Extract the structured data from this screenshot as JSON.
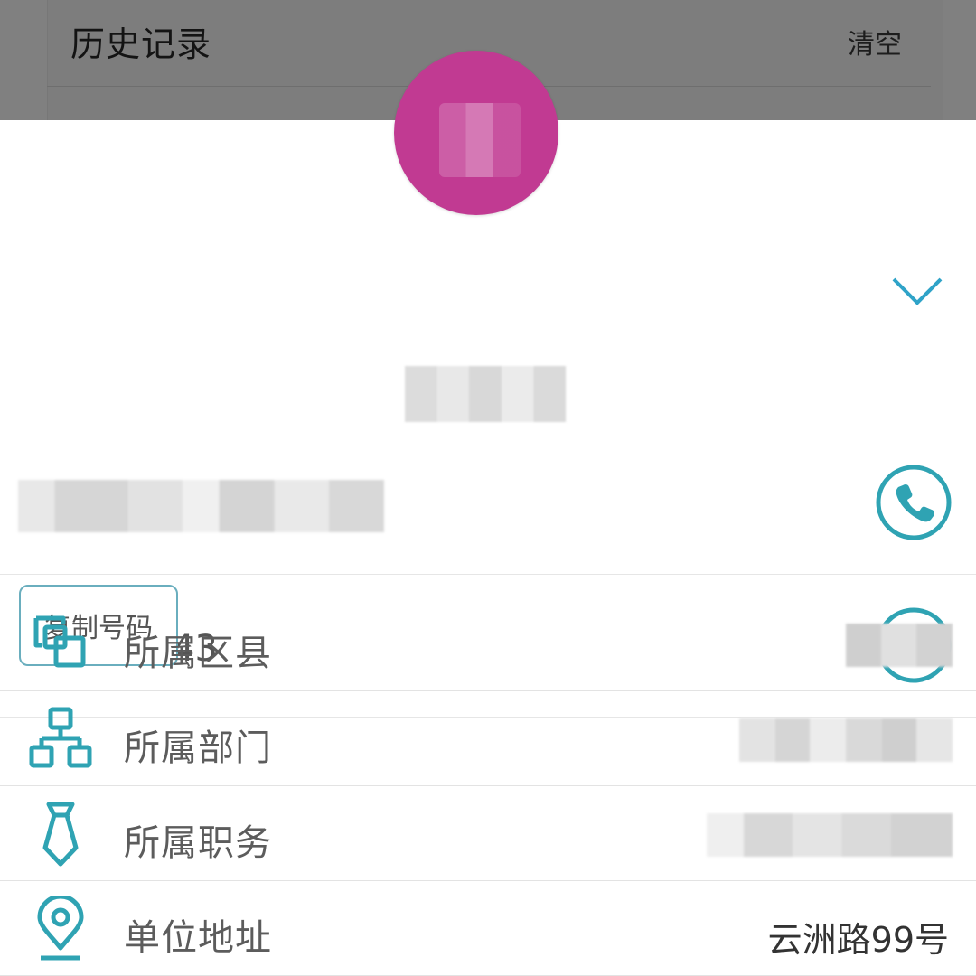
{
  "history": {
    "title": "历史记录",
    "clear_label": "清空"
  },
  "contact": {
    "phones": [
      {
        "number_visible": ""
      },
      {
        "number_visible": "43"
      }
    ],
    "copy_tooltip": "复制号码",
    "fields": [
      {
        "icon": "copy-squares-icon",
        "label": "所属区县",
        "value": ""
      },
      {
        "icon": "org-chart-icon",
        "label": "所属部门",
        "value": ""
      },
      {
        "icon": "tie-icon",
        "label": "所属职务",
        "value": ""
      },
      {
        "icon": "location-pin-icon",
        "label": "单位地址",
        "value": "云洲路99号"
      }
    ]
  },
  "colors": {
    "accent": "#2fa3b3",
    "avatar": "#c13a92",
    "overlay": "#808080"
  }
}
